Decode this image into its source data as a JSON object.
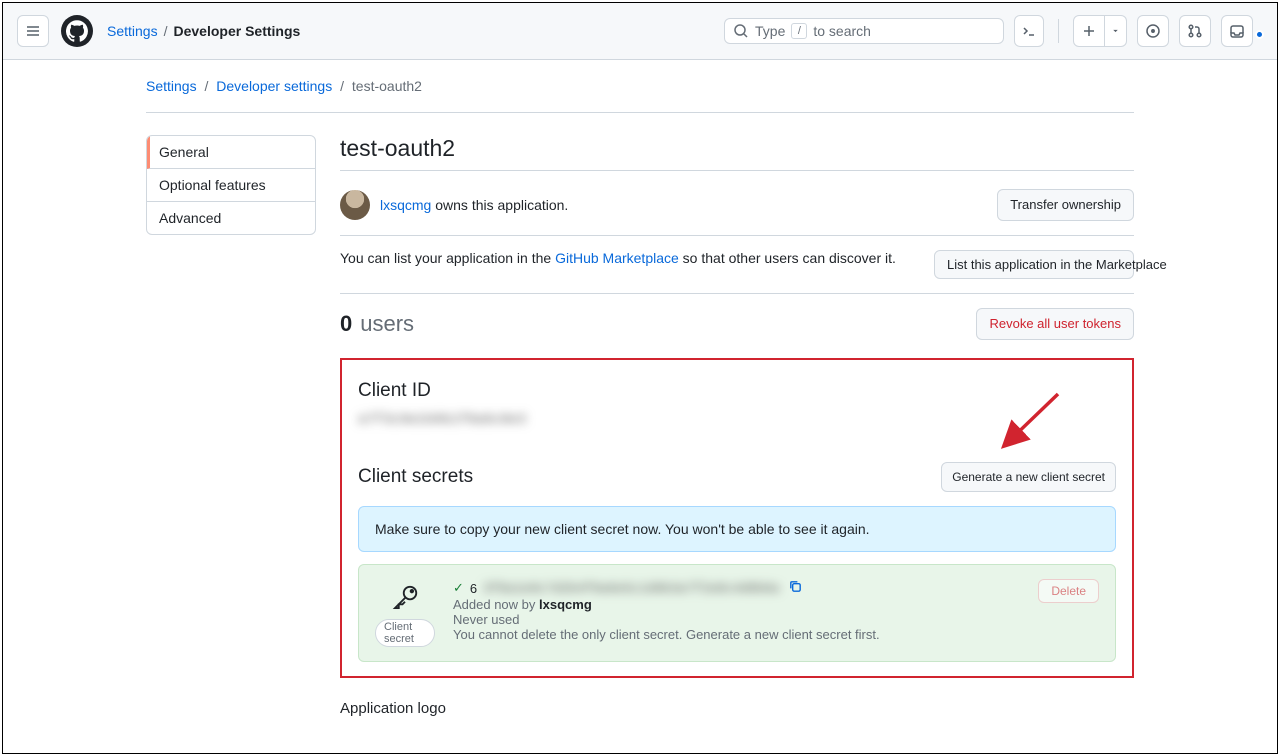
{
  "header": {
    "crumb1": "Settings",
    "crumb2": "Developer Settings",
    "search_placeholder_pre": "Type",
    "search_placeholder_post": "to search"
  },
  "breadcrumbs": {
    "a": "Settings",
    "b": "Developer settings",
    "c": "test-oauth2"
  },
  "nav": {
    "general": "General",
    "optional": "Optional features",
    "advanced": "Advanced"
  },
  "page": {
    "title": "test-oauth2",
    "owner_user": "lxsqcmg",
    "owns_text": " owns this application.",
    "transfer_btn": "Transfer ownership",
    "marketplace_pre": "You can list your application in the ",
    "marketplace_link": "GitHub Marketplace",
    "marketplace_post": " so that other users can discover it.",
    "list_btn": "List this application in the Marketplace",
    "users_count": "0",
    "users_label": "users",
    "revoke_btn": "Revoke all user tokens"
  },
  "client": {
    "id_heading": "Client ID",
    "id_value": "a7f3c9e2d4b1f8a6c0e3",
    "secrets_heading": "Client secrets",
    "generate_btn": "Generate a new client secret",
    "flash": "Make sure to copy your new client secret now. You won't be able to see it again.",
    "secret_chip": "Client secret",
    "secret_prefix": "6",
    "secret_masked": "3f8a1e9c7d2b4f0a6e5c1d9b3a7f2e8c4d0b6a",
    "added_pre": "Added now by ",
    "added_user": "lxsqcmg",
    "never_used": "Never used",
    "cannot_delete": "You cannot delete the only client secret. Generate a new client secret first.",
    "delete_btn": "Delete"
  },
  "footer": {
    "app_logo_heading": "Application logo"
  }
}
